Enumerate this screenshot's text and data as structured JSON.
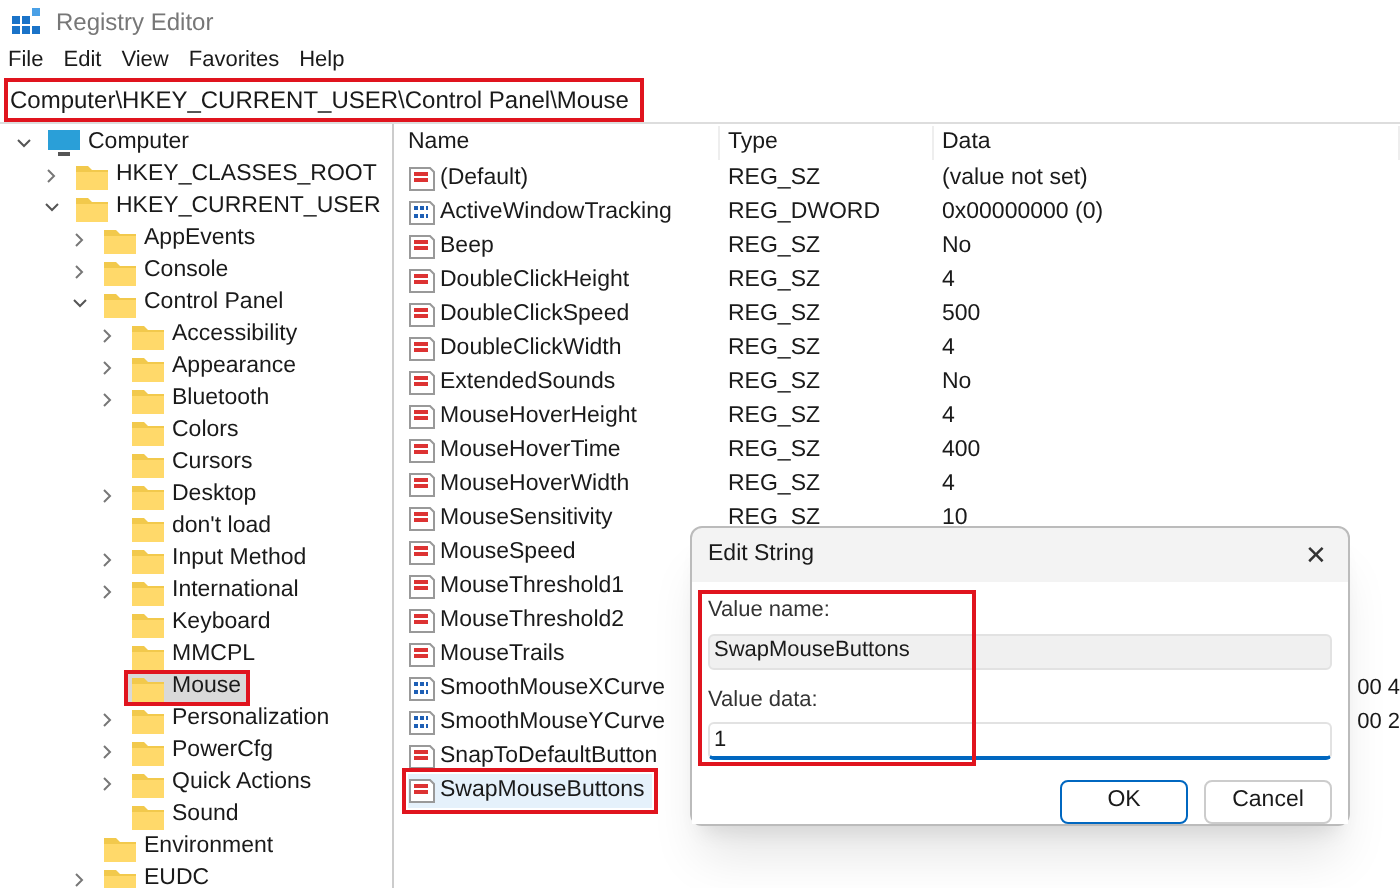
{
  "window": {
    "title": "Registry Editor"
  },
  "menu": [
    "File",
    "Edit",
    "View",
    "Favorites",
    "Help"
  ],
  "address_bar": {
    "value": "Computer\\HKEY_CURRENT_USER\\Control Panel\\Mouse",
    "highlighted": true
  },
  "tree": [
    {
      "label": "Computer",
      "kind": "computer",
      "expanded": true,
      "selected": false,
      "highlighted": false,
      "children": [
        {
          "label": "HKEY_CLASSES_ROOT",
          "kind": "folder",
          "expanded": false,
          "has_children": true,
          "selected": false,
          "highlighted": false
        },
        {
          "label": "HKEY_CURRENT_USER",
          "kind": "folder",
          "expanded": true,
          "has_children": true,
          "selected": false,
          "highlighted": false,
          "children": [
            {
              "label": "AppEvents",
              "kind": "folder",
              "expanded": false,
              "has_children": true,
              "selected": false,
              "highlighted": false
            },
            {
              "label": "Console",
              "kind": "folder",
              "expanded": false,
              "has_children": true,
              "selected": false,
              "highlighted": false
            },
            {
              "label": "Control Panel",
              "kind": "folder",
              "expanded": true,
              "has_children": true,
              "selected": false,
              "highlighted": false,
              "children": [
                {
                  "label": "Accessibility",
                  "kind": "folder",
                  "expanded": false,
                  "has_children": true,
                  "selected": false,
                  "highlighted": false
                },
                {
                  "label": "Appearance",
                  "kind": "folder",
                  "expanded": false,
                  "has_children": true,
                  "selected": false,
                  "highlighted": false
                },
                {
                  "label": "Bluetooth",
                  "kind": "folder",
                  "expanded": false,
                  "has_children": true,
                  "selected": false,
                  "highlighted": false
                },
                {
                  "label": "Colors",
                  "kind": "folder",
                  "expanded": false,
                  "has_children": false,
                  "selected": false,
                  "highlighted": false
                },
                {
                  "label": "Cursors",
                  "kind": "folder",
                  "expanded": false,
                  "has_children": false,
                  "selected": false,
                  "highlighted": false
                },
                {
                  "label": "Desktop",
                  "kind": "folder",
                  "expanded": false,
                  "has_children": true,
                  "selected": false,
                  "highlighted": false
                },
                {
                  "label": "don't load",
                  "kind": "folder",
                  "expanded": false,
                  "has_children": false,
                  "selected": false,
                  "highlighted": false
                },
                {
                  "label": "Input Method",
                  "kind": "folder",
                  "expanded": false,
                  "has_children": true,
                  "selected": false,
                  "highlighted": false
                },
                {
                  "label": "International",
                  "kind": "folder",
                  "expanded": false,
                  "has_children": true,
                  "selected": false,
                  "highlighted": false
                },
                {
                  "label": "Keyboard",
                  "kind": "folder",
                  "expanded": false,
                  "has_children": false,
                  "selected": false,
                  "highlighted": false
                },
                {
                  "label": "MMCPL",
                  "kind": "folder",
                  "expanded": false,
                  "has_children": false,
                  "selected": false,
                  "highlighted": false
                },
                {
                  "label": "Mouse",
                  "kind": "folder",
                  "expanded": false,
                  "has_children": false,
                  "selected": true,
                  "highlighted": true
                },
                {
                  "label": "Personalization",
                  "kind": "folder",
                  "expanded": false,
                  "has_children": true,
                  "selected": false,
                  "highlighted": false
                },
                {
                  "label": "PowerCfg",
                  "kind": "folder",
                  "expanded": false,
                  "has_children": true,
                  "selected": false,
                  "highlighted": false
                },
                {
                  "label": "Quick Actions",
                  "kind": "folder",
                  "expanded": false,
                  "has_children": true,
                  "selected": false,
                  "highlighted": false
                },
                {
                  "label": "Sound",
                  "kind": "folder",
                  "expanded": false,
                  "has_children": false,
                  "selected": false,
                  "highlighted": false
                }
              ]
            },
            {
              "label": "Environment",
              "kind": "folder",
              "expanded": false,
              "has_children": false,
              "selected": false,
              "highlighted": false
            },
            {
              "label": "EUDC",
              "kind": "folder",
              "expanded": false,
              "has_children": true,
              "selected": false,
              "highlighted": false
            }
          ]
        }
      ]
    }
  ],
  "table": {
    "columns": [
      "Name",
      "Type",
      "Data"
    ],
    "rows": [
      {
        "kind": "string",
        "name": "(Default)",
        "type": "REG_SZ",
        "data": "(value not set)",
        "highlighted": false
      },
      {
        "kind": "binary",
        "name": "ActiveWindowTracking",
        "type": "REG_DWORD",
        "data": "0x00000000 (0)",
        "highlighted": false
      },
      {
        "kind": "string",
        "name": "Beep",
        "type": "REG_SZ",
        "data": "No",
        "highlighted": false
      },
      {
        "kind": "string",
        "name": "DoubleClickHeight",
        "type": "REG_SZ",
        "data": "4",
        "highlighted": false
      },
      {
        "kind": "string",
        "name": "DoubleClickSpeed",
        "type": "REG_SZ",
        "data": "500",
        "highlighted": false
      },
      {
        "kind": "string",
        "name": "DoubleClickWidth",
        "type": "REG_SZ",
        "data": "4",
        "highlighted": false
      },
      {
        "kind": "string",
        "name": "ExtendedSounds",
        "type": "REG_SZ",
        "data": "No",
        "highlighted": false
      },
      {
        "kind": "string",
        "name": "MouseHoverHeight",
        "type": "REG_SZ",
        "data": "4",
        "highlighted": false
      },
      {
        "kind": "string",
        "name": "MouseHoverTime",
        "type": "REG_SZ",
        "data": "400",
        "highlighted": false
      },
      {
        "kind": "string",
        "name": "MouseHoverWidth",
        "type": "REG_SZ",
        "data": "4",
        "highlighted": false
      },
      {
        "kind": "string",
        "name": "MouseSensitivity",
        "type": "REG_SZ",
        "data": "10",
        "highlighted": false
      },
      {
        "kind": "string",
        "name": "MouseSpeed",
        "highlighted": false
      },
      {
        "kind": "string",
        "name": "MouseThreshold1",
        "highlighted": false
      },
      {
        "kind": "string",
        "name": "MouseThreshold2",
        "highlighted": false
      },
      {
        "kind": "string",
        "name": "MouseTrails",
        "highlighted": false
      },
      {
        "kind": "binary",
        "name": "SmoothMouseXCurve",
        "data_tail": "00 4",
        "highlighted": false
      },
      {
        "kind": "binary",
        "name": "SmoothMouseYCurve",
        "data_tail": "00 2",
        "highlighted": false
      },
      {
        "kind": "string",
        "name": "SnapToDefaultButton",
        "highlighted": false
      },
      {
        "kind": "string",
        "name": "SwapMouseButtons",
        "highlighted": true
      }
    ]
  },
  "dialog": {
    "title": "Edit String",
    "close": "✕",
    "value_name_label": "Value name:",
    "value_name": "SwapMouseButtons",
    "value_data_label": "Value data:",
    "value_data": "1",
    "highlighted": true,
    "buttons": [
      {
        "label": "OK",
        "primary": true
      },
      {
        "label": "Cancel",
        "primary": false
      }
    ]
  }
}
